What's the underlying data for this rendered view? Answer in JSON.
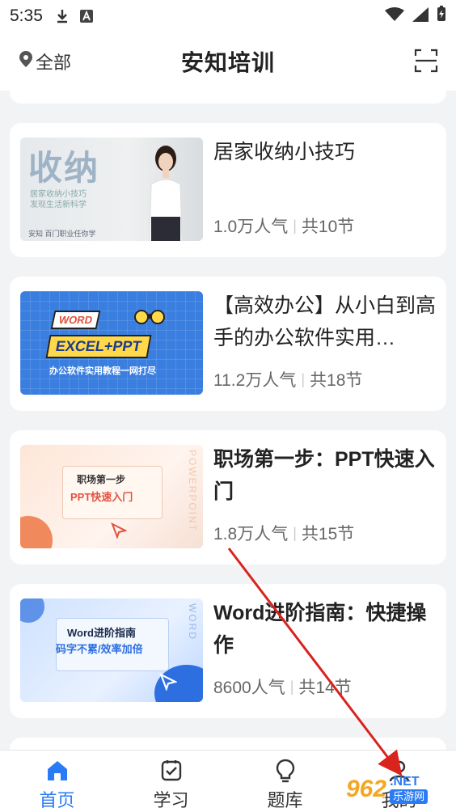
{
  "status_bar": {
    "time": "5:35"
  },
  "header": {
    "location_label": "全部",
    "title": "安知培训"
  },
  "courses": [
    {
      "title": "居家收纳小技巧",
      "popularity": "1.0万人气",
      "lessons": "共10节",
      "thumb": {
        "big": "收纳",
        "sub1": "居家收纳小技巧",
        "sub2": "发现生活新科学",
        "foot": "安知 百门职业任你学"
      }
    },
    {
      "title": "【高效办公】从小白到高手的办公软件实用…",
      "popularity": "11.2万人气",
      "lessons": "共18节",
      "thumb": {
        "word": "WORD",
        "excel": "EXCEL+PPT",
        "line": "办公软件实用教程一网打尽"
      }
    },
    {
      "title": "职场第一步：PPT快速入门",
      "popularity": "1.8万人气",
      "lessons": "共15节",
      "thumb": {
        "a": "职场第一步",
        "b": "PPT快速入门",
        "side": "POWERPOINT"
      }
    },
    {
      "title": "Word进阶指南：快捷操作",
      "popularity": "8600人气",
      "lessons": "共14节",
      "thumb": {
        "a": "Word进阶指南",
        "b": "码字不累/效率加倍",
        "side": "WORD"
      }
    }
  ],
  "bottom_nav": [
    {
      "label": "首页",
      "icon": "home-icon",
      "active": true
    },
    {
      "label": "学习",
      "icon": "study-icon",
      "active": false
    },
    {
      "label": "题库",
      "icon": "bulb-icon",
      "active": false
    },
    {
      "label": "我的",
      "icon": "profile-icon",
      "active": false
    }
  ],
  "watermark": {
    "logo": "962",
    "net": ".NET",
    "cn": "乐游网"
  },
  "colors": {
    "accent": "#2a7bf6",
    "annotation_arrow": "#d9231e"
  }
}
